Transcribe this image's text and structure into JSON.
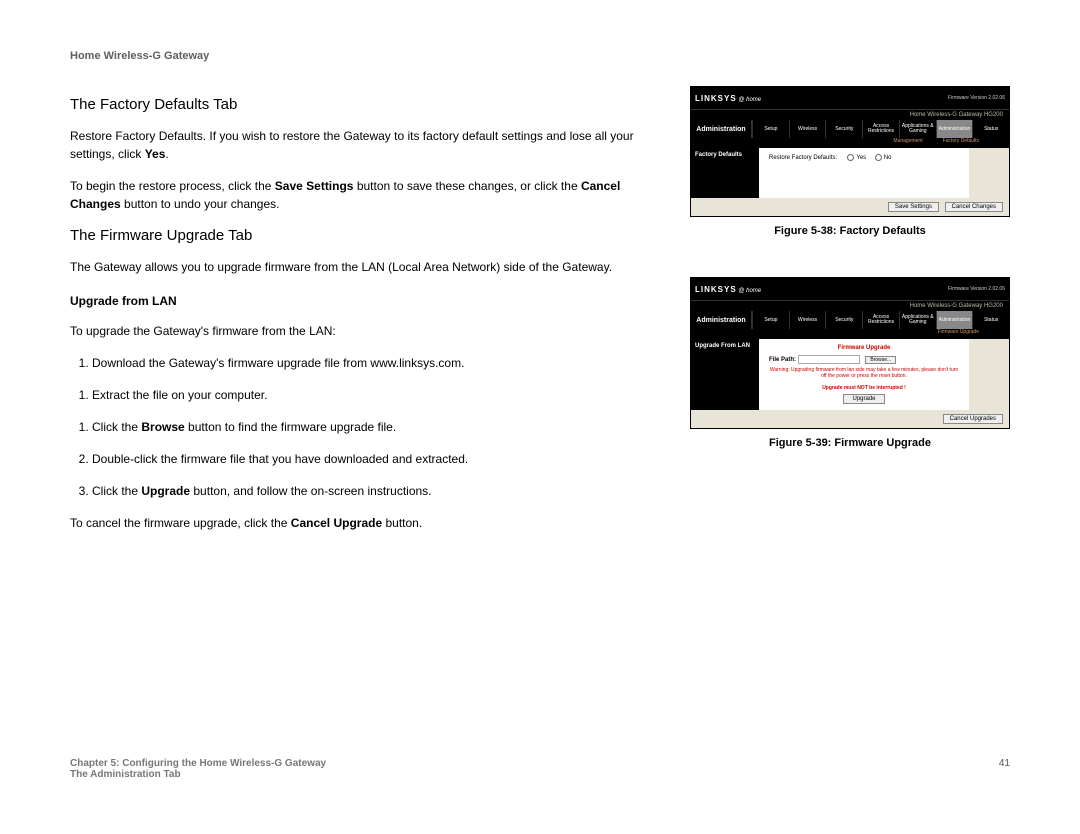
{
  "header": {
    "doc_title": "Home Wireless-G Gateway"
  },
  "sections": {
    "factory_defaults": {
      "heading": "The Factory Defaults Tab",
      "p1_a": "Restore Factory Defaults. If you wish to restore the Gateway to its factory default settings and lose all your settings, click ",
      "p1_b": "Yes",
      "p1_c": ".",
      "p2_a": "To begin the restore process, click the ",
      "p2_b": "Save Settings",
      "p2_c": " button to save these changes, or click the ",
      "p2_d": "Cancel Changes",
      "p2_e": " button to undo your changes."
    },
    "firmware_upgrade": {
      "heading": "The Firmware Upgrade Tab",
      "p1": "The Gateway allows you to upgrade firmware from the LAN (Local Area Network) side of the Gateway.",
      "sub_heading": "Upgrade from LAN",
      "p2": "To upgrade the Gateway's firmware from the LAN:",
      "steps": {
        "s1": "Download the Gateway's firmware upgrade file from www.linksys.com.",
        "s2": "Extract the file on your computer.",
        "s3_a": "Click the ",
        "s3_b": "Browse",
        "s3_c": " button to find the firmware upgrade file.",
        "s4": "Double-click the firmware file that you have downloaded and extracted.",
        "s5_a": "Click the ",
        "s5_b": "Upgrade",
        "s5_c": " button, and follow the on-screen instructions."
      },
      "p3_a": "To cancel the firmware upgrade, click the ",
      "p3_b": "Cancel Upgrade",
      "p3_c": " button."
    }
  },
  "figures": {
    "f38": {
      "caption": "Figure 5-38: Factory Defaults",
      "logo": "LINKSYS",
      "logo_sub": "@ home",
      "fw_version": "Firmware Version 2.02.06",
      "title_bar": "Home Wireless-G Gateway     HG200",
      "nav_label": "Administration",
      "tabs": [
        "Setup",
        "Wireless",
        "Security",
        "Access Restrictions",
        "Applications & Gaming",
        "Administration",
        "Status"
      ],
      "subnav": [
        "Management",
        "Factory Defaults"
      ],
      "side_label": "Factory Defaults",
      "content_label": "Restore Factory Defaults:",
      "yes": "Yes",
      "no": "No",
      "btn_save": "Save Settings",
      "btn_cancel": "Cancel Changes"
    },
    "f39": {
      "caption": "Figure 5-39: Firmware Upgrade",
      "logo": "LINKSYS",
      "logo_sub": "@ home",
      "fw_version": "Firmware Version 2.02.06",
      "title_bar": "Home Wireless-G Gateway     HG200",
      "nav_label": "Administration",
      "tabs": [
        "Setup",
        "Wireless",
        "Security",
        "Access Restrictions",
        "Applications & Gaming",
        "Administration",
        "Status"
      ],
      "subnav": [
        "Firmware Upgrade"
      ],
      "side_label": "Upgrade From LAN",
      "red_title": "Firmware Upgrade",
      "file_path_label": "File Path:",
      "browse": "Browse...",
      "warning": "Warning: Upgrading firmware from lan side may take a few minutes, please don't turn off the power or press the reset button.",
      "center_warn": "Upgrade must NOT be interrupted !",
      "upgrade_btn": "Upgrade",
      "btn_cancel": "Cancel Upgrades"
    }
  },
  "footer": {
    "line1": "Chapter 5: Configuring the Home Wireless-G Gateway",
    "line2": "The Administration Tab",
    "page_num": "41"
  }
}
